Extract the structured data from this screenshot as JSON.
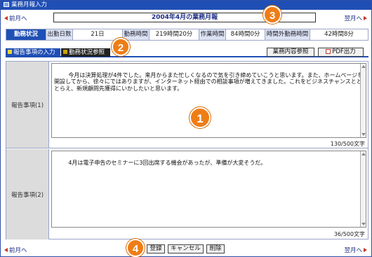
{
  "window": {
    "title": "業務月報入力"
  },
  "nav": {
    "prev": "前月へ",
    "next": "翌月へ",
    "month_title": "2004年4月の業務月報"
  },
  "stats": {
    "heading": "勤務状況",
    "items": [
      {
        "label": "出勤日数",
        "value": "21日"
      },
      {
        "label": "勤務時間",
        "value": "219時間20分"
      },
      {
        "label": "作業時間",
        "value": "84時間0分"
      },
      {
        "label": "時間外勤務時間",
        "value": "42時間8分"
      }
    ]
  },
  "tabs": [
    {
      "label": "報告事項の入力",
      "active": true
    },
    {
      "label": "勤務状況参照",
      "active": false
    }
  ],
  "toolbar": {
    "refer_label": "業務内容参照",
    "pdf_label": "PDF出力"
  },
  "reports": [
    {
      "label": "報告事項(1)",
      "text": "今月は決算処理が4件でした。来月からまた忙しくなるので気を引き締めていこうと思います。また、ホームページを開設してから、徐々にではありますが、インターネット経由での相談事項が増えてきました。これをビジネスチャンスとととらえ、新規顧問先獲得にいかしたいと思います。",
      "count": "130/500文字"
    },
    {
      "label": "報告事項(2)",
      "text": "4月は電子申告のセミナーに3回出席する機会があったが、準備が大変そうだ。",
      "count": "36/500文字"
    }
  ],
  "actions": {
    "register": "登録",
    "cancel": "キャンセル",
    "delete": "削除"
  },
  "badges": [
    "1",
    "2",
    "3",
    "4"
  ],
  "colors": {
    "accent": "#1f4fb5",
    "callout": "#ef7d16"
  }
}
